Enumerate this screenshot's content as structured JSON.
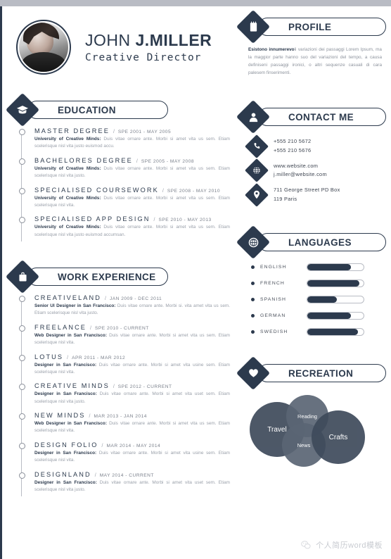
{
  "header": {
    "first_name": "JOHN",
    "last_name": "J.MILLER",
    "job_title": "Creative Director",
    "avatar_alt": "portrait-photo"
  },
  "profile": {
    "title": "PROFILE",
    "icon": "document-icon",
    "lead": "Esistono innumerevo",
    "text": "li variazioni dei passaggi Lorem Ipsum, ma la maggior parte hanno suo del variazioni del tempo, a causa definiseni passaggi ironici, o altri sequenze casuali di cara palesem finserimenti."
  },
  "education": {
    "title": "EDUCATION",
    "icon": "graduation-cap-icon",
    "entries": [
      {
        "title": "MASTER DEGREE",
        "sep": "/",
        "date": "SPE 2001 - MAY 2005",
        "org": "University of Creative Minds:",
        "desc": " Duis vitae ornare ante. Morbi si amet vita us sem. Etiam scelerisque nisl vita justo euismod accu."
      },
      {
        "title": "BACHELORES DEGREE",
        "sep": "/",
        "date": "SPE 2005 - MAY 2008",
        "org": "University of Creative Minds:",
        "desc": " Duis vitae ornare ante. Morbi si amet vita us sem. Etiam scelerisque nisl vita justo."
      },
      {
        "title": "SPECIALISED COURSEWORK",
        "sep": "/",
        "date": "SPE 2008 - MAY 2010",
        "org": "University of Creative Minds:",
        "desc": " Duis vitae ornare ante. Morbi si amet vita us sem. Etiam scelerisque nisl vita."
      },
      {
        "title": "SPECIALISED APP DESIGN",
        "sep": "/",
        "date": "SPE 2010 - MAY 2013",
        "org": "University of Creative Minds:",
        "desc": " Duis vitae ornare ante. Morbi si amet vita us sem. Etiam scelerisque nisl vita justo euismod accumsan."
      }
    ]
  },
  "work": {
    "title": "WORK EXPERIENCE",
    "icon": "briefcase-icon",
    "entries": [
      {
        "title": "CREATIVELAND",
        "sep": "/",
        "date": "JAN 2009 - DEC 2011",
        "org": "Senior UI Designer in San Francisco:",
        "desc": " Duis vitae ornare ante. Morbi si. vita amet vita us sem. Etiam scelerisque nisl vita justo."
      },
      {
        "title": "FREELANCE",
        "sep": "/",
        "date": "SPE 2010 - CURRENT",
        "org": "Web Designer in San Francisco:",
        "desc": " Duis vitae ornare ante. Morbi si amet vita us sem. Etiam scelerisque nisl vita."
      },
      {
        "title": "LOTUS",
        "sep": "/",
        "date": "APR 2011 - MAR 2012",
        "org": "Designer in San Francisco:",
        "desc": " Duis vitae ornare ante. Morbi si amet vita usine sem. Etiam scelerisque nisl vita."
      },
      {
        "title": "CREATIVE MINDS",
        "sep": "/",
        "date": "SPE 2012 - CURRENT",
        "org": "Designer in San Francisco:",
        "desc": " Duis vitae ornare ante. Morbi si amet vita uset sem. Etiam scelerisque nisl vita justo."
      },
      {
        "title": "NEW MINDS",
        "sep": "/",
        "date": "MAR 2013 - JAN 2014",
        "org": "Web Designer in San Francisco:",
        "desc": " Duis vitae ornare ante. Morbi si amet vita us sem. Etiam scelerisque nisl vita."
      },
      {
        "title": "DESIGN FOLIO",
        "sep": "/",
        "date": "MAR 2014 - MAY 2014",
        "org": "Designer in San Francisco:",
        "desc": " Duis vitae ornare ante. Morbi si amet vita usine sem. Etiam scelerisque nisl vita."
      },
      {
        "title": "DESIGNLAND",
        "sep": "/",
        "date": "MAY 2014 - CURRENT",
        "org": "Designer in San Francisco:",
        "desc": " Duis vitae ornare ante. Morbi si amet vita uset sem. Etiam scelerisque nisl vita justo."
      }
    ]
  },
  "contact": {
    "title": "CONTACT ME",
    "icon": "person-icon",
    "rows": [
      {
        "icon": "phone-icon",
        "line1": "+555  210  5672",
        "line2": "+555  210  5676"
      },
      {
        "icon": "globe-icon",
        "line1": "www.website.com",
        "line2": "j.miller@website.com"
      },
      {
        "icon": "location-pin-icon",
        "line1": "711 George Street PD Box",
        "line2": "119 Paris"
      }
    ]
  },
  "languages": {
    "title": "LANGUAGES",
    "icon": "globe-languages-icon",
    "items": [
      {
        "name": "ENGLISH",
        "level": 78
      },
      {
        "name": "FRENCH",
        "level": 92
      },
      {
        "name": "SPANISH",
        "level": 52
      },
      {
        "name": "GERMAN",
        "level": 77
      },
      {
        "name": "SWEDISH",
        "level": 90
      }
    ]
  },
  "recreation": {
    "title": "RECREATION",
    "icon": "heart-icon",
    "bubbles": [
      {
        "label": "Travel",
        "color": "#3e4a5b"
      },
      {
        "label": "Reading",
        "color": "#5b6675"
      },
      {
        "label": "News",
        "color": "#5b6675"
      },
      {
        "label": "Crafts",
        "color": "#3e4a5b"
      }
    ]
  },
  "watermark": {
    "icon": "wechat-icon",
    "text": "个人简历word模板"
  },
  "colors": {
    "accent": "#2c3a4d",
    "muted": "#9aa0aa",
    "rule": "#b9bcc4"
  }
}
